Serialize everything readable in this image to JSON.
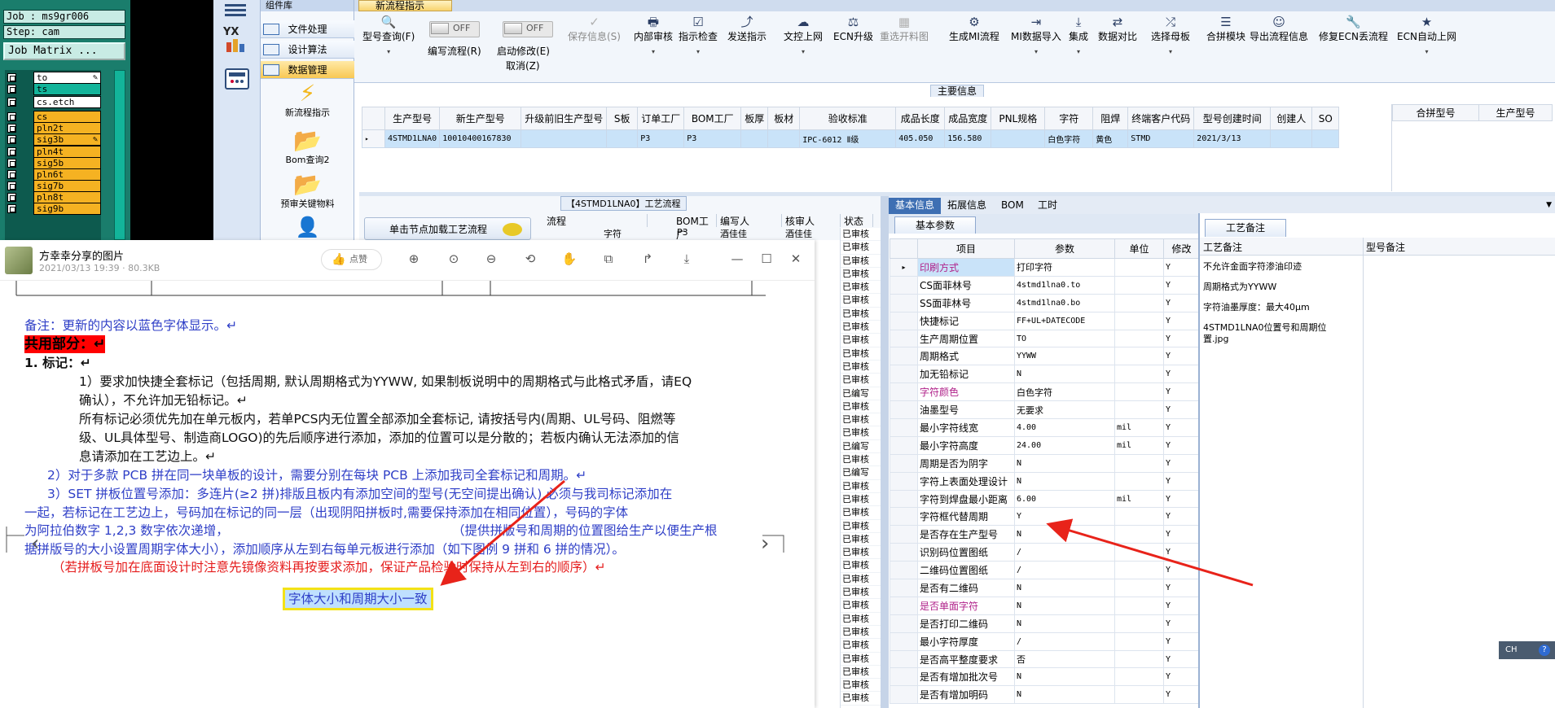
{
  "cam": {
    "job": "Job : ms9gr006",
    "step": "Step: cam",
    "matrix_button": "Job Matrix ...",
    "layers": [
      {
        "name": "to",
        "tag": "✎",
        "color": "#ffffff"
      },
      {
        "name": "ts",
        "tag": "",
        "color": "#13b49a"
      },
      {
        "name": "cs.etch",
        "tag": "",
        "color": "#ffffff"
      },
      {
        "name": "cs",
        "tag": "",
        "color": "#f5b222"
      },
      {
        "name": "pln2t",
        "tag": "",
        "color": "#f5b222"
      },
      {
        "name": "sig3b",
        "tag": "✎",
        "color": "#f5b222"
      },
      {
        "name": "pln4t",
        "tag": "",
        "color": "#f5b222"
      },
      {
        "name": "sig5b",
        "tag": "",
        "color": "#f5b222"
      },
      {
        "name": "pln6t",
        "tag": "",
        "color": "#f5b222"
      },
      {
        "name": "sig7b",
        "tag": "",
        "color": "#f5b222"
      },
      {
        "name": "pln8t",
        "tag": "",
        "color": "#f5b222"
      },
      {
        "name": "sig9b",
        "tag": "",
        "color": "#f5b222"
      }
    ]
  },
  "vtool": {
    "logo": "YX"
  },
  "complib": {
    "header": "组件库",
    "items": [
      "文件处理",
      "设计算法",
      "数据管理"
    ],
    "big_items": [
      "新流程指示",
      "Bom查询2",
      "预审关键物料"
    ]
  },
  "toolbar": {
    "tab": "新流程指示",
    "buttons": [
      {
        "icon": "🔍",
        "label": "型号查询(F)",
        "dd": "▾",
        "dis": false
      },
      {
        "icon": "✓",
        "label": "保存信息(S)",
        "dd": "",
        "dis": true
      },
      {
        "icon": "🖶",
        "label": "内部审核",
        "dd": "▾",
        "dis": false
      },
      {
        "icon": "☑",
        "label": "指示检查",
        "dd": "▾",
        "dis": false
      },
      {
        "icon": "⤴",
        "label": "发送指示",
        "dd": "",
        "dis": false
      },
      {
        "icon": "☁",
        "label": "文控上网",
        "dd": "▾",
        "dis": false
      },
      {
        "icon": "⚖",
        "label": "ECN升级",
        "dd": "",
        "dis": false
      },
      {
        "icon": "▦",
        "label": "重选开料图",
        "dd": "",
        "dis": true
      },
      {
        "icon": "⚙",
        "label": "生成MI流程",
        "dd": "",
        "dis": false
      },
      {
        "icon": "⇥",
        "label": "MI数据导入",
        "dd": "▾",
        "dis": false
      },
      {
        "icon": "⤓",
        "label": "集成",
        "dd": "▾",
        "dis": false
      },
      {
        "icon": "⇄",
        "label": "数据对比",
        "dd": "",
        "dis": false
      },
      {
        "icon": "⤮",
        "label": "选择母板",
        "dd": "▾",
        "dis": false
      },
      {
        "icon": "☰",
        "label": "合拼模块",
        "dd": "",
        "dis": false
      },
      {
        "icon": "☺",
        "label": "导出流程信息",
        "dd": "",
        "dis": false
      },
      {
        "icon": "🔧",
        "label": "修复ECN丢流程",
        "dd": "",
        "dis": false
      },
      {
        "icon": "★",
        "label": "ECN自动上网",
        "dd": "▾",
        "dis": false
      }
    ],
    "toggles": [
      {
        "state": "OFF",
        "label": "编写流程(R)",
        "sub": ""
      },
      {
        "state": "OFF",
        "label": "启动修改(E)",
        "sub": "取消(Z)"
      }
    ]
  },
  "main_info": {
    "title": "主要信息",
    "columns": [
      "",
      "生产型号",
      "新生产型号",
      "升级前旧生产型号",
      "S板",
      "订单工厂",
      "BOM工厂",
      "板厚",
      "板材",
      "验收标准",
      "成品长度",
      "成品宽度",
      "PNL规格",
      "字符",
      "阻焊",
      "终端客户代码",
      "型号创建时间",
      "创建人",
      "SO"
    ],
    "row": [
      "▸",
      "4STMD1LNA0",
      "10010400167830",
      "",
      "",
      "P3",
      "P3",
      "",
      "",
      "IPC-6012 Ⅱ级",
      "405.050",
      "156.580",
      "",
      "白色字符",
      "黄色",
      "STMD",
      "2021/3/13",
      "",
      ""
    ],
    "side_columns": [
      "合拼型号",
      "生产型号"
    ]
  },
  "flow": {
    "title": "【4STMD1LNA0】工艺流程",
    "node_button": "单击节点加载工艺流程",
    "headers": [
      "流程",
      "BOM工厂",
      "编写人",
      "核审人",
      "状态"
    ],
    "row": [
      "字符",
      "P3",
      "酒佳佳",
      "酒佳佳"
    ]
  },
  "status": [
    "已审核",
    "已审核",
    "已审核",
    "已审核",
    "已审核",
    "已审核",
    "已审核",
    "已审核",
    "已审核",
    "已审核",
    "已审核",
    "已审核",
    "已编写",
    "已审核",
    "已审核",
    "已审核",
    "已编写",
    "已审核",
    "已编写",
    "已审核",
    "已审核",
    "已审核",
    "已审核",
    "已审核",
    "已审核",
    "已审核",
    "已审核",
    "已审核",
    "已审核",
    "已审核",
    "已审核",
    "已审核",
    "已审核",
    "已审核",
    "已审核",
    "已审核"
  ],
  "viewer": {
    "title": "方幸幸分享的图片",
    "meta": "2021/03/13 19:39 · 80.3KB",
    "like": "点赞",
    "lines": [
      {
        "text": "备注：更新的内容以蓝色字体显示。↵",
        "cls": "blue"
      },
      {
        "text": "共用部分：↵",
        "cls": "red"
      },
      {
        "text": "1.    标记：↵",
        "cls": "black"
      },
      {
        "text": "1）要求加快捷全套标记（包括周期, 默认周期格式为YYWW, 如果制板说明中的周期格式与此格式矛盾，请EQ",
        "cls": "black"
      },
      {
        "text": "确认），不允许加无铅标记。↵",
        "cls": "black"
      },
      {
        "text": "所有标记必须优先加在单元板内，若单PCS内无位置全部添加全套标记, 请按括号内(周期、UL号码、阻燃等",
        "cls": "black"
      },
      {
        "text": "级、UL具体型号、制造商LOGO)的先后顺序进行添加，添加的位置可以是分散的；若板内确认无法添加的信",
        "cls": "black"
      },
      {
        "text": "息请添加在工艺边上。↵",
        "cls": "black"
      },
      {
        "text": "2）对于多款 PCB 拼在同一块单板的设计，需要分别在每块 PCB 上添加我司全套标记和周期。↵",
        "cls": "blue"
      },
      {
        "text": "3）SET 拼板位置号添加：多连片(≥2 拼)排版且板内有添加空间的型号(无空间提出确认),必须与我司标记添加在",
        "cls": "blue"
      },
      {
        "text": "一起，若标记在工艺边上，号码加在标记的同一层（出现阴阳拼板时,需要保持添加在相同位置），号码的字体",
        "cls": "blue"
      },
      {
        "text": "为阿拉伯数字  1,2,3  数字依次递增，",
        "cls": "blue"
      },
      {
        "text": "（提供拼版号和周期的位置图给生产以便生产根",
        "cls": "blue"
      },
      {
        "text": "据拼版号的大小设置周期字体大小），添加顺序从左到右每单元板进行添加（如下图例 9 拼和 6 拼的情况）。",
        "cls": "blue"
      },
      {
        "text": "（若拼板号加在底面设计时注意先镜像资料再按要求添加，保证产品检验时保持从左到右的顺序）↵",
        "cls": "red"
      }
    ],
    "highlight": "字体大小和周期大小一致"
  },
  "detail": {
    "tabs": [
      "基本信息",
      "拓展信息",
      "BOM",
      "工时"
    ],
    "subtab": "基本参数",
    "columns": [
      "",
      "项目",
      "参数",
      "单位",
      "修改"
    ],
    "rows": [
      {
        "ind": "▸",
        "name": "印刷方式",
        "value": "打印字符",
        "unit": "",
        "mod": "Y",
        "pink": true,
        "mono": false,
        "sel": true
      },
      {
        "ind": "",
        "name": "CS面菲林号",
        "value": "4stmd1lna0.to",
        "unit": "",
        "mod": "Y",
        "pink": false,
        "mono": true,
        "sel": false
      },
      {
        "ind": "",
        "name": "SS面菲林号",
        "value": "4stmd1lna0.bo",
        "unit": "",
        "mod": "Y",
        "pink": false,
        "mono": true,
        "sel": false
      },
      {
        "ind": "",
        "name": "快捷标记",
        "value": "FF+UL+DATECODE",
        "unit": "",
        "mod": "Y",
        "pink": false,
        "mono": true,
        "sel": false
      },
      {
        "ind": "",
        "name": "生产周期位置",
        "value": "TO",
        "unit": "",
        "mod": "Y",
        "pink": false,
        "mono": true,
        "sel": false
      },
      {
        "ind": "",
        "name": "周期格式",
        "value": "YYWW",
        "unit": "",
        "mod": "Y",
        "pink": false,
        "mono": true,
        "sel": false
      },
      {
        "ind": "",
        "name": "加无铅标记",
        "value": "N",
        "unit": "",
        "mod": "Y",
        "pink": false,
        "mono": true,
        "sel": false
      },
      {
        "ind": "",
        "name": "字符颜色",
        "value": "白色字符",
        "unit": "",
        "mod": "Y",
        "pink": true,
        "mono": false,
        "sel": false
      },
      {
        "ind": "",
        "name": "油墨型号",
        "value": "无要求",
        "unit": "",
        "mod": "Y",
        "pink": false,
        "mono": false,
        "sel": false
      },
      {
        "ind": "",
        "name": "最小字符线宽",
        "value": "4.00",
        "unit": "mil",
        "mod": "Y",
        "pink": false,
        "mono": true,
        "sel": false
      },
      {
        "ind": "",
        "name": "最小字符高度",
        "value": "24.00",
        "unit": "mil",
        "mod": "Y",
        "pink": false,
        "mono": true,
        "sel": false
      },
      {
        "ind": "",
        "name": "周期是否为阴字",
        "value": "N",
        "unit": "",
        "mod": "Y",
        "pink": false,
        "mono": true,
        "sel": false
      },
      {
        "ind": "",
        "name": "字符上表面处理设计",
        "value": "N",
        "unit": "",
        "mod": "Y",
        "pink": false,
        "mono": true,
        "sel": false
      },
      {
        "ind": "",
        "name": "字符到焊盘最小距离",
        "value": "6.00",
        "unit": "mil",
        "mod": "Y",
        "pink": false,
        "mono": true,
        "sel": false
      },
      {
        "ind": "",
        "name": "字符框代替周期",
        "value": "Y",
        "unit": "",
        "mod": "Y",
        "pink": false,
        "mono": true,
        "sel": false
      },
      {
        "ind": "",
        "name": "是否存在生产型号",
        "value": "N",
        "unit": "",
        "mod": "Y",
        "pink": false,
        "mono": true,
        "sel": false
      },
      {
        "ind": "",
        "name": "识别码位置图纸",
        "value": "/",
        "unit": "",
        "mod": "Y",
        "pink": false,
        "mono": true,
        "sel": false
      },
      {
        "ind": "",
        "name": "二维码位置图纸",
        "value": "/",
        "unit": "",
        "mod": "Y",
        "pink": false,
        "mono": true,
        "sel": false
      },
      {
        "ind": "",
        "name": "是否有二维码",
        "value": "N",
        "unit": "",
        "mod": "Y",
        "pink": false,
        "mono": true,
        "sel": false
      },
      {
        "ind": "",
        "name": "是否单面字符",
        "value": "N",
        "unit": "",
        "mod": "Y",
        "pink": true,
        "mono": true,
        "sel": false
      },
      {
        "ind": "",
        "name": "是否打印二维码",
        "value": "N",
        "unit": "",
        "mod": "Y",
        "pink": false,
        "mono": true,
        "sel": false
      },
      {
        "ind": "",
        "name": "最小字符厚度",
        "value": "/",
        "unit": "",
        "mod": "Y",
        "pink": false,
        "mono": true,
        "sel": false
      },
      {
        "ind": "",
        "name": "是否高平整度要求",
        "value": "否",
        "unit": "",
        "mod": "Y",
        "pink": false,
        "mono": false,
        "sel": false
      },
      {
        "ind": "",
        "name": "是否有增加批次号",
        "value": "N",
        "unit": "",
        "mod": "Y",
        "pink": false,
        "mono": true,
        "sel": false
      },
      {
        "ind": "",
        "name": "是否有增加明码",
        "value": "N",
        "unit": "",
        "mod": "Y",
        "pink": false,
        "mono": true,
        "sel": false
      }
    ]
  },
  "craft": {
    "tab": "工艺备注",
    "col1": "工艺备注",
    "col2": "型号备注",
    "notes": [
      "不允许金面字符渗油印迹",
      "周期格式为YYWW",
      "字符油墨厚度：最大40μm",
      "4STMD1LNA0位置号和周期位",
      "置.jpg"
    ]
  },
  "tray": {
    "lang": "CH",
    "help": "?"
  }
}
